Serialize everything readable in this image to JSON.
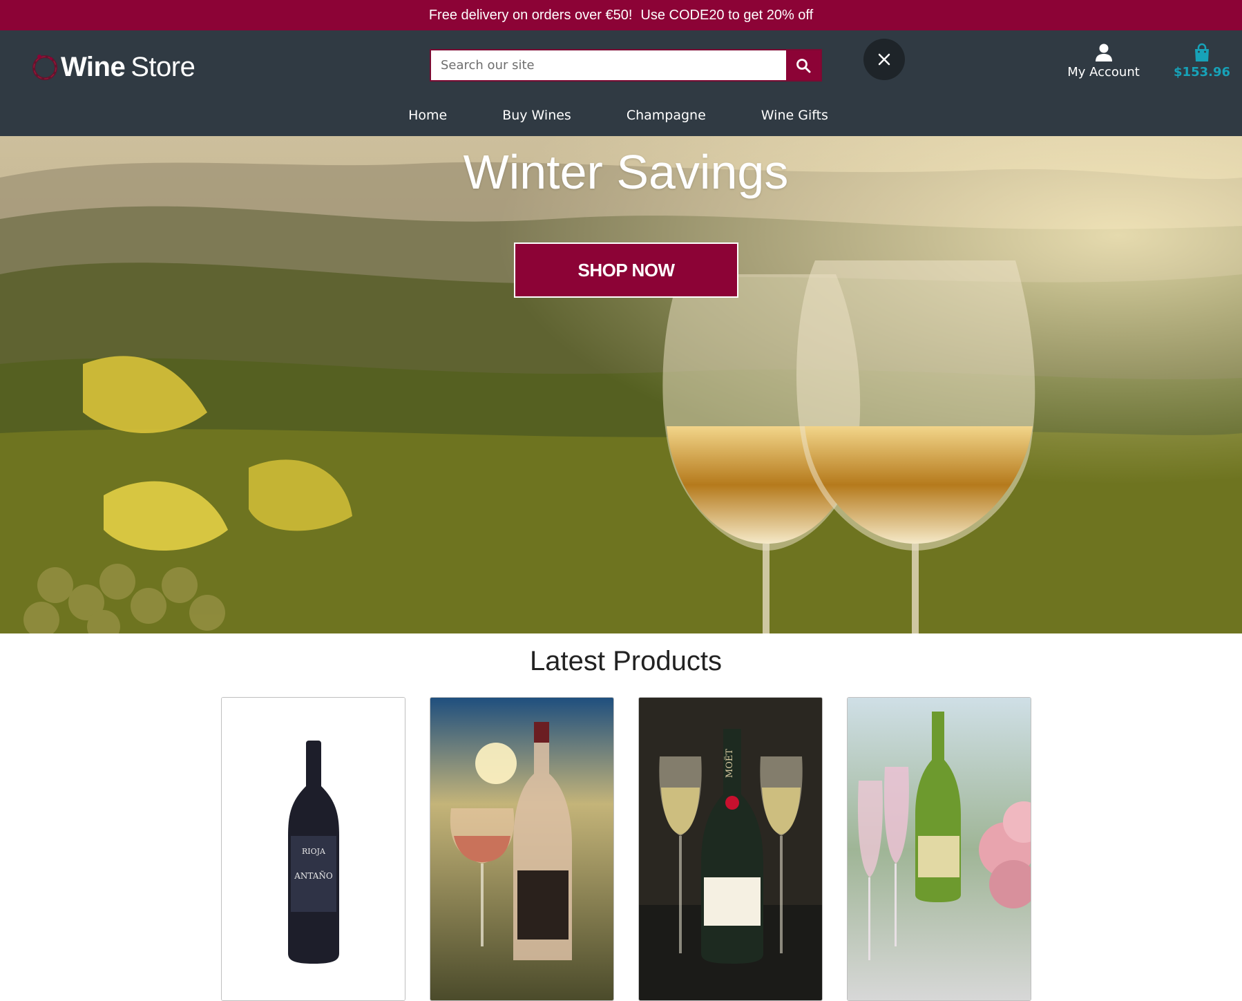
{
  "promo": {
    "text_1": "Free delivery on orders over €50!",
    "text_2": "Use CODE20 to get 20% off"
  },
  "header": {
    "logo_word_1": "Wine",
    "logo_word_2": "Store",
    "search": {
      "placeholder": "Search our site",
      "value": ""
    },
    "account_label": "My Account",
    "cart_total": "$153.96"
  },
  "nav": {
    "items": [
      {
        "label": "Home"
      },
      {
        "label": "Buy Wines"
      },
      {
        "label": "Champagne"
      },
      {
        "label": "Wine Gifts"
      }
    ]
  },
  "hero": {
    "title": "Winter Savings",
    "button_label": "SHOP NOW"
  },
  "latest": {
    "title": "Latest Products",
    "products": [
      {
        "image": "red-wine-bottle",
        "bottle_label": "RIOJA ANTAÑO"
      },
      {
        "image": "rose-wine-glass-and-bottle"
      },
      {
        "image": "champagne-bottle-and-flutes",
        "bottle_label": "MOËT"
      },
      {
        "image": "pink-champagne-flutes-and-flowers"
      }
    ]
  },
  "colors": {
    "brand": "#8c0336",
    "header_bg": "#303a43",
    "cart_accent": "#17a2b8"
  }
}
